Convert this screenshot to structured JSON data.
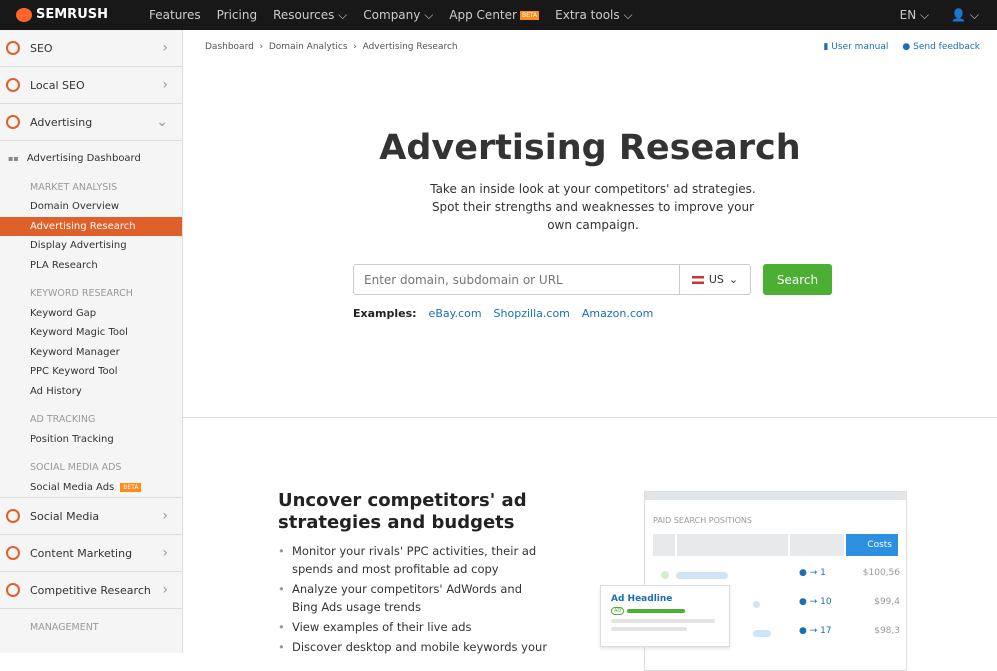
{
  "topbar": {
    "brand": "SEMRUSH",
    "nav": [
      "Features",
      "Pricing",
      "Resources",
      "Company",
      "App Center",
      "Extra tools"
    ],
    "beta": "BETA",
    "lang": "EN"
  },
  "sidebar": {
    "groups_top": [
      "SEO",
      "Local SEO",
      "Advertising"
    ],
    "items": [
      {
        "label": "Advertising Dashboard",
        "type": "item"
      },
      {
        "label": "MARKET ANALYSIS",
        "type": "header"
      },
      {
        "label": "Domain Overview",
        "type": "item"
      },
      {
        "label": "Advertising Research",
        "type": "active"
      },
      {
        "label": "Display Advertising",
        "type": "item"
      },
      {
        "label": "PLA Research",
        "type": "item"
      },
      {
        "label": "KEYWORD RESEARCH",
        "type": "header"
      },
      {
        "label": "Keyword Gap",
        "type": "item"
      },
      {
        "label": "Keyword Magic Tool",
        "type": "item"
      },
      {
        "label": "Keyword Manager",
        "type": "item"
      },
      {
        "label": "PPC Keyword Tool",
        "type": "item"
      },
      {
        "label": "Ad History",
        "type": "item"
      },
      {
        "label": "AD TRACKING",
        "type": "header"
      },
      {
        "label": "Position Tracking",
        "type": "item"
      },
      {
        "label": "SOCIAL MEDIA ADS",
        "type": "header"
      },
      {
        "label": "Social Media Ads",
        "type": "item"
      }
    ],
    "sma_badge": "BETA",
    "groups_bottom": [
      "Social Media",
      "Content Marketing",
      "Competitive Research"
    ],
    "management": "MANAGEMENT"
  },
  "breadcrumb": [
    "Dashboard",
    "Domain Analytics",
    "Advertising Research"
  ],
  "links": {
    "manual": "User manual",
    "feedback": "Send feedback"
  },
  "hero": {
    "title": "Advertising Research",
    "desc": "Take an inside look at your competitors' ad strategies. Spot their strengths and weaknesses to improve your own campaign.",
    "placeholder": "Enter domain, subdomain or URL",
    "db": "US",
    "search": "Search",
    "examples_label": "Examples:",
    "examples": [
      "eBay.com",
      "Shopzilla.com",
      "Amazon.com"
    ]
  },
  "promo": {
    "title": "Uncover competitors' ad strategies and budgets",
    "bullets": [
      "Monitor your rivals' PPC activities, their ad spends and most profitable ad copy",
      "Analyze your competitors' AdWords and Bing Ads usage trends",
      "View examples of their live ads",
      "Discover desktop and mobile keywords your"
    ]
  },
  "illustration": {
    "title": "PAID SEARCH POSITIONS",
    "costs": "Costs",
    "rows": [
      {
        "pos": "1",
        "cost": "$100,56"
      },
      {
        "pos": "10",
        "cost": "$99,4"
      },
      {
        "pos": "17",
        "cost": "$98,3"
      }
    ],
    "ad_headline": "Ad Headline",
    "ad_tag": "AD"
  }
}
